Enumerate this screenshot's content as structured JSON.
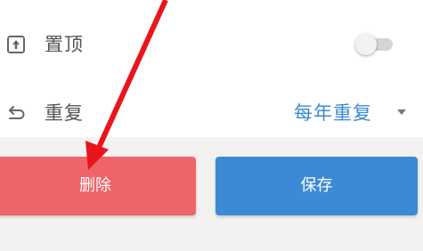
{
  "settings": {
    "pin_label": "置顶",
    "pin_enabled": false,
    "repeat_label": "重复",
    "repeat_value": "每年重复"
  },
  "actions": {
    "delete_label": "删除",
    "save_label": "保存"
  },
  "colors": {
    "delete_button": "#ee6469",
    "save_button": "#3c8ad6",
    "repeat_value_text": "#3c8ad0",
    "annotation_arrow": "#e8161c"
  },
  "icons": {
    "pin": "pin-to-top-icon",
    "repeat": "repeat-icon",
    "dropdown": "dropdown-caret-icon",
    "annotation": "red-annotation-arrow"
  }
}
